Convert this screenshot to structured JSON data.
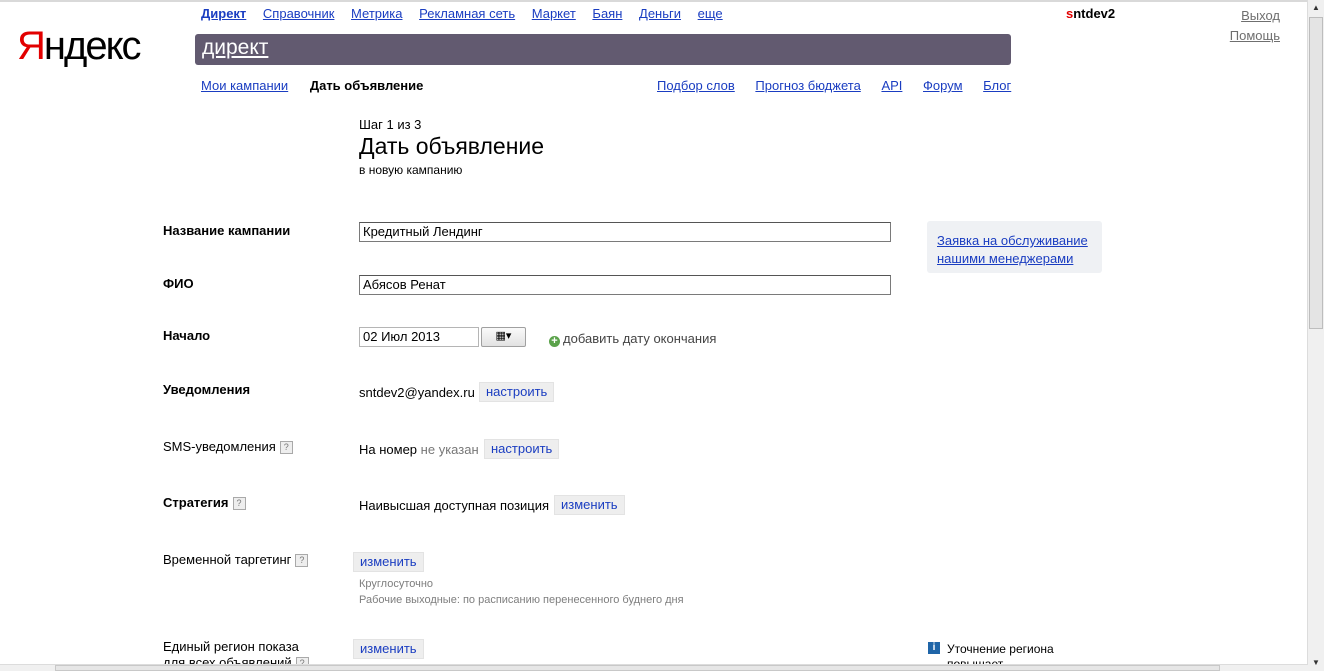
{
  "header": {
    "logo_first": "Я",
    "logo_rest": "ндекс",
    "services": [
      "Директ",
      "Справочник",
      "Метрика",
      "Рекламная сеть",
      "Маркет",
      "Баян",
      "Деньги",
      "еще"
    ],
    "user_first": "s",
    "user_rest": "ntdev2",
    "logout": "Выход",
    "help": "Помощь",
    "search_text": "директ"
  },
  "subnav": {
    "my_campaigns": "Мои кампании",
    "current": "Дать объявление",
    "right": [
      "Подбор слов",
      "Прогноз бюджета",
      "API",
      "Форум",
      "Блог"
    ]
  },
  "page": {
    "step": "Шаг 1 из 3",
    "title": "Дать объявление",
    "subtitle": "в новую кампанию"
  },
  "form": {
    "campaign_label": "Название кампании",
    "campaign_value": "Кредитный Лендинг",
    "fio_label": "ФИО",
    "fio_value": "Абясов Ренат",
    "start_label": "Начало",
    "start_value": "02 Июл 2013",
    "calendar_icon": "calendar-icon",
    "add_end_date": "добавить дату окончания",
    "notifications_label": "Уведомления",
    "notifications_email": "sntdev2@yandex.ru",
    "configure": "настроить",
    "sms_label": "SMS-уведомления",
    "sms_prefix": "На номер",
    "sms_status": "не указан",
    "strategy_label": "Стратегия",
    "strategy_value": "Наивысшая доступная позиция",
    "change": "изменить",
    "time_target_label": "Временной таргетинг",
    "time_target_line1": "Круглосуточно",
    "time_target_line2": "Рабочие выходные: по расписанию перенесенного буднего дня",
    "region_label_1": "Единый регион показа",
    "region_label_2": "для всех объявлений",
    "help_mark": "?"
  },
  "sidebar": {
    "manager_request": "Заявка на обслуживание нашими менеджерами",
    "region_info_1": "Уточнение региона",
    "region_info_2": "повышает"
  }
}
